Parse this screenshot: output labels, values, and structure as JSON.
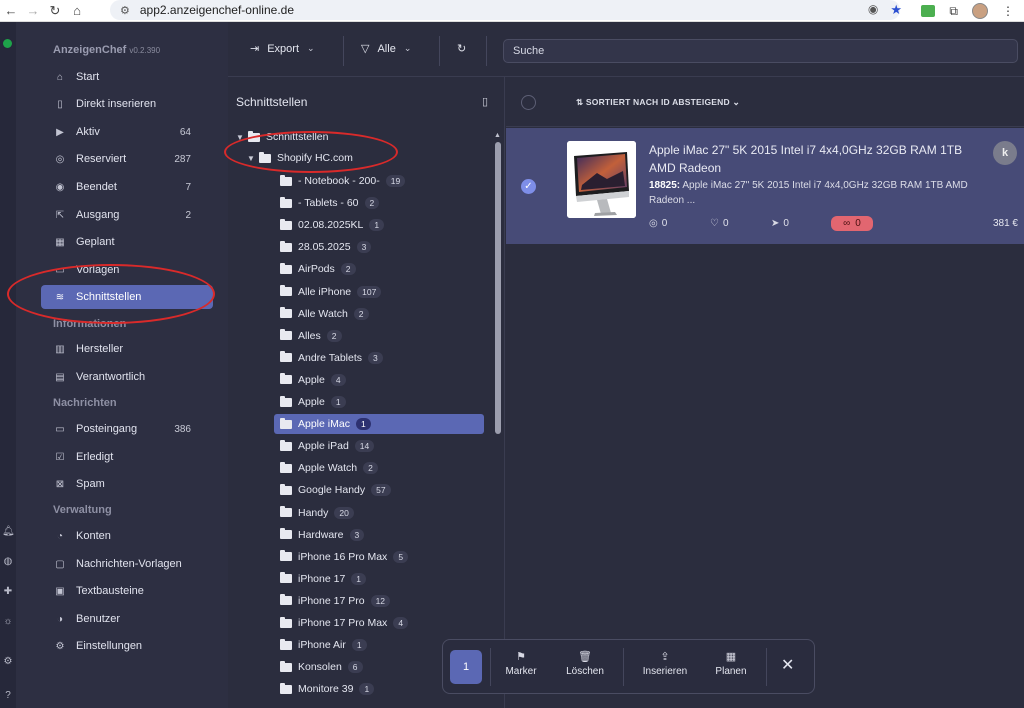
{
  "browser": {
    "url": "app2.anzeigenchef-online.de"
  },
  "app": {
    "brand": "AnzeigenChef",
    "version": "v0.2.390"
  },
  "sidebar": {
    "items": [
      {
        "label": "Start",
        "count": "",
        "icon": "home-icon"
      },
      {
        "label": "Direkt inserieren",
        "count": "",
        "icon": "file-icon"
      },
      {
        "label": "Aktiv",
        "count": "64",
        "icon": "play-icon"
      },
      {
        "label": "Reserviert",
        "count": "287",
        "icon": "pause-icon"
      },
      {
        "label": "Beendet",
        "count": "7",
        "icon": "stop-icon"
      },
      {
        "label": "Ausgang",
        "count": "2",
        "icon": "outbox-icon"
      },
      {
        "label": "Geplant",
        "count": "",
        "icon": "calendar-icon"
      },
      {
        "label": "Vorlagen",
        "count": "",
        "icon": "template-icon"
      },
      {
        "label": "Schnittstellen",
        "count": "",
        "icon": "database-icon"
      }
    ],
    "section_info": "Informationen",
    "info_items": [
      {
        "label": "Hersteller",
        "icon": "factory-icon"
      },
      {
        "label": "Verantwortlich",
        "icon": "id-card-icon"
      }
    ],
    "section_messages": "Nachrichten",
    "message_items": [
      {
        "label": "Posteingang",
        "count": "386",
        "icon": "inbox-icon"
      },
      {
        "label": "Erledigt",
        "count": "",
        "icon": "check-square-icon"
      },
      {
        "label": "Spam",
        "count": "",
        "icon": "spam-icon"
      }
    ],
    "section_admin": "Verwaltung",
    "admin_items": [
      {
        "label": "Konten",
        "icon": "user-icon"
      },
      {
        "label": "Nachrichten-Vorlagen",
        "icon": "message-template-icon"
      },
      {
        "label": "Textbausteine",
        "icon": "text-block-icon"
      },
      {
        "label": "Benutzer",
        "icon": "users-icon"
      },
      {
        "label": "Einstellungen",
        "icon": "gear-icon"
      }
    ]
  },
  "toolbar": {
    "export_label": "Export",
    "filter_label": "Alle",
    "search_placeholder": "Suche"
  },
  "tree": {
    "title": "Schnittstellen",
    "root_label": "Schnittstellen",
    "shop_label": "Shopify HC.com",
    "folders": [
      {
        "label": "- Notebook - 200-",
        "count": "19"
      },
      {
        "label": "- Tablets - 60",
        "count": "2"
      },
      {
        "label": "02.08.2025KL",
        "count": "1"
      },
      {
        "label": "28.05.2025",
        "count": "3"
      },
      {
        "label": "AirPods",
        "count": "2"
      },
      {
        "label": "Alle iPhone",
        "count": "107"
      },
      {
        "label": "Alle Watch",
        "count": "2"
      },
      {
        "label": "Alles",
        "count": "2"
      },
      {
        "label": "Andre Tablets",
        "count": "3"
      },
      {
        "label": "Apple",
        "count": "4"
      },
      {
        "label": "Apple",
        "count": "1"
      },
      {
        "label": "Apple iMac",
        "count": "1"
      },
      {
        "label": "Apple iPad",
        "count": "14"
      },
      {
        "label": "Apple Watch",
        "count": "2"
      },
      {
        "label": "Google Handy",
        "count": "57"
      },
      {
        "label": "Handy",
        "count": "20"
      },
      {
        "label": "Hardware",
        "count": "3"
      },
      {
        "label": "iPhone 16 Pro Max",
        "count": "5"
      },
      {
        "label": "iPhone 17",
        "count": "1"
      },
      {
        "label": "iPhone 17 Pro",
        "count": "12"
      },
      {
        "label": "iPhone 17 Pro Max",
        "count": "4"
      },
      {
        "label": "iPhone Air",
        "count": "1"
      },
      {
        "label": "Konsolen",
        "count": "6"
      },
      {
        "label": "Monitore 39",
        "count": "1"
      }
    ],
    "selected_index": 11
  },
  "content": {
    "sort_label": "SORTIERT NACH ID ABSTEIGEND",
    "listing": {
      "title": "Apple iMac 27\" 5K 2015 Intel i7 4x4,0GHz 32GB RAM 1TB AMD Radeon",
      "id": "18825:",
      "description": "Apple iMac 27\" 5K 2015 Intel i7 4x4,0GHz 32GB RAM 1TB AMD Radeon ...",
      "views": "0",
      "likes": "0",
      "shares": "0",
      "links": "0",
      "price": "381 €",
      "avatar_letter": "k"
    }
  },
  "actionbar": {
    "selected_count": "1",
    "marker": "Marker",
    "delete": "Löschen",
    "publish": "Inserieren",
    "plan": "Planen"
  },
  "colors": {
    "accent": "#5b68b4",
    "annotation": "#d92a2a",
    "status_online": "#1ea34a",
    "link_badge": "#e26670"
  }
}
